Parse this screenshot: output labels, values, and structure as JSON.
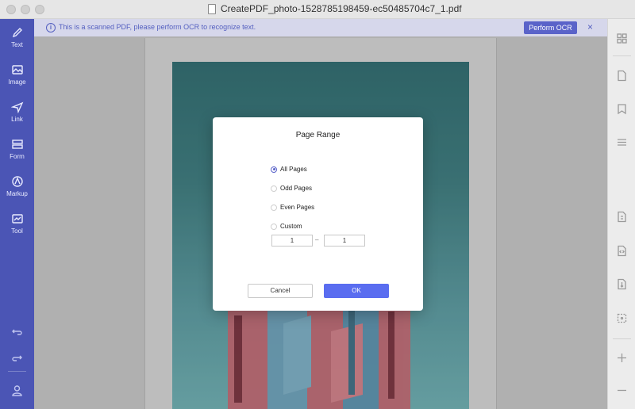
{
  "window": {
    "title": "CreatePDF_photo-1528785198459-ec50485704c7_1.pdf"
  },
  "sidebar": {
    "items": [
      {
        "label": "Text",
        "icon": "pencil-icon"
      },
      {
        "label": "Image",
        "icon": "image-icon"
      },
      {
        "label": "Link",
        "icon": "link-icon"
      },
      {
        "label": "Form",
        "icon": "form-icon"
      },
      {
        "label": "Markup",
        "icon": "markup-icon"
      },
      {
        "label": "Tool",
        "icon": "toolbox-icon"
      }
    ],
    "bottom_icons": [
      "undo-icon",
      "redo-icon",
      "user-icon"
    ]
  },
  "banner": {
    "message": "This is a scanned PDF, please perform OCR to recognize text.",
    "button_label": "Perform OCR",
    "close_glyph": "×"
  },
  "dialog": {
    "title": "Page Range",
    "options": [
      {
        "label": "All Pages",
        "selected": true
      },
      {
        "label": "Odd Pages",
        "selected": false
      },
      {
        "label": "Even Pages",
        "selected": false
      },
      {
        "label": "Custom",
        "selected": false
      }
    ],
    "range_from": "1",
    "range_separator": "–",
    "range_to": "1",
    "cancel_label": "Cancel",
    "ok_label": "OK"
  },
  "right_toolbar": {
    "icons": [
      "thumbnails-icon",
      "page-icon",
      "bookmark-icon",
      "outline-icon",
      "extract-icon",
      "convert-icon",
      "compress-icon",
      "crop-icon",
      "zoom-in-icon",
      "zoom-out-icon"
    ]
  },
  "colors": {
    "sidebar": "#4b55b5",
    "accent": "#5a63c9",
    "ok_button": "#5a6df0",
    "banner_bg": "#d6d7eb"
  }
}
